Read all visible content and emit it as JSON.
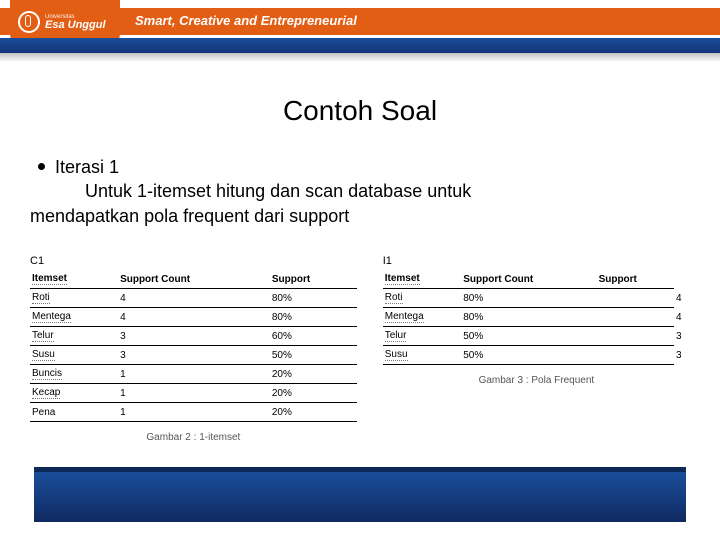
{
  "header": {
    "logo_small": "Universitas",
    "logo_name": "Esa Unggul",
    "tagline": "Smart, Creative and Entrepreneurial"
  },
  "title": "Contoh Soal",
  "bullet": {
    "line1": "Iterasi 1",
    "line2": "Untuk 1-itemset hitung dan scan database untuk",
    "line3": "mendapatkan pola frequent dari support"
  },
  "table_left": {
    "label": "C1",
    "headers": [
      "Itemset",
      "Support Count",
      "Support"
    ],
    "rows": [
      [
        "Roti",
        "4",
        "80%"
      ],
      [
        "Mentega",
        "4",
        "80%"
      ],
      [
        "Telur",
        "3",
        "60%"
      ],
      [
        "Susu",
        "3",
        "50%"
      ],
      [
        "Buncis",
        "1",
        "20%"
      ],
      [
        "Kecap",
        "1",
        "20%"
      ],
      [
        "Pena",
        "1",
        "20%"
      ]
    ],
    "caption": "Gambar 2 : 1-itemset"
  },
  "table_right": {
    "label": "I1",
    "headers": [
      "Itemset",
      "Support Count",
      "Support",
      ""
    ],
    "rows": [
      [
        "Roti",
        "80%",
        "",
        "4"
      ],
      [
        "Mentega",
        "80%",
        "",
        "4"
      ],
      [
        "Telur",
        "50%",
        "",
        "3"
      ],
      [
        "Susu",
        "50%",
        "",
        "3"
      ]
    ],
    "caption": "Gambar 3 : Pola Frequent"
  },
  "chart_data": [
    {
      "type": "table",
      "title": "C1 — 1-itemset candidate counts",
      "columns": [
        "Itemset",
        "Support Count",
        "Support"
      ],
      "rows": [
        {
          "Itemset": "Roti",
          "Support Count": 4,
          "Support": "80%"
        },
        {
          "Itemset": "Mentega",
          "Support Count": 4,
          "Support": "80%"
        },
        {
          "Itemset": "Telur",
          "Support Count": 3,
          "Support": "60%"
        },
        {
          "Itemset": "Susu",
          "Support Count": 3,
          "Support": "50%"
        },
        {
          "Itemset": "Buncis",
          "Support Count": 1,
          "Support": "20%"
        },
        {
          "Itemset": "Kecap",
          "Support Count": 1,
          "Support": "20%"
        },
        {
          "Itemset": "Pena",
          "Support Count": 1,
          "Support": "20%"
        }
      ]
    },
    {
      "type": "table",
      "title": "I1 — Frequent 1-itemsets",
      "columns": [
        "Itemset",
        "Support Count",
        "Support"
      ],
      "rows": [
        {
          "Itemset": "Roti",
          "Support Count": 4,
          "Support": "80%"
        },
        {
          "Itemset": "Mentega",
          "Support Count": 4,
          "Support": "80%"
        },
        {
          "Itemset": "Telur",
          "Support Count": 3,
          "Support": "50%"
        },
        {
          "Itemset": "Susu",
          "Support Count": 3,
          "Support": "50%"
        }
      ]
    }
  ]
}
